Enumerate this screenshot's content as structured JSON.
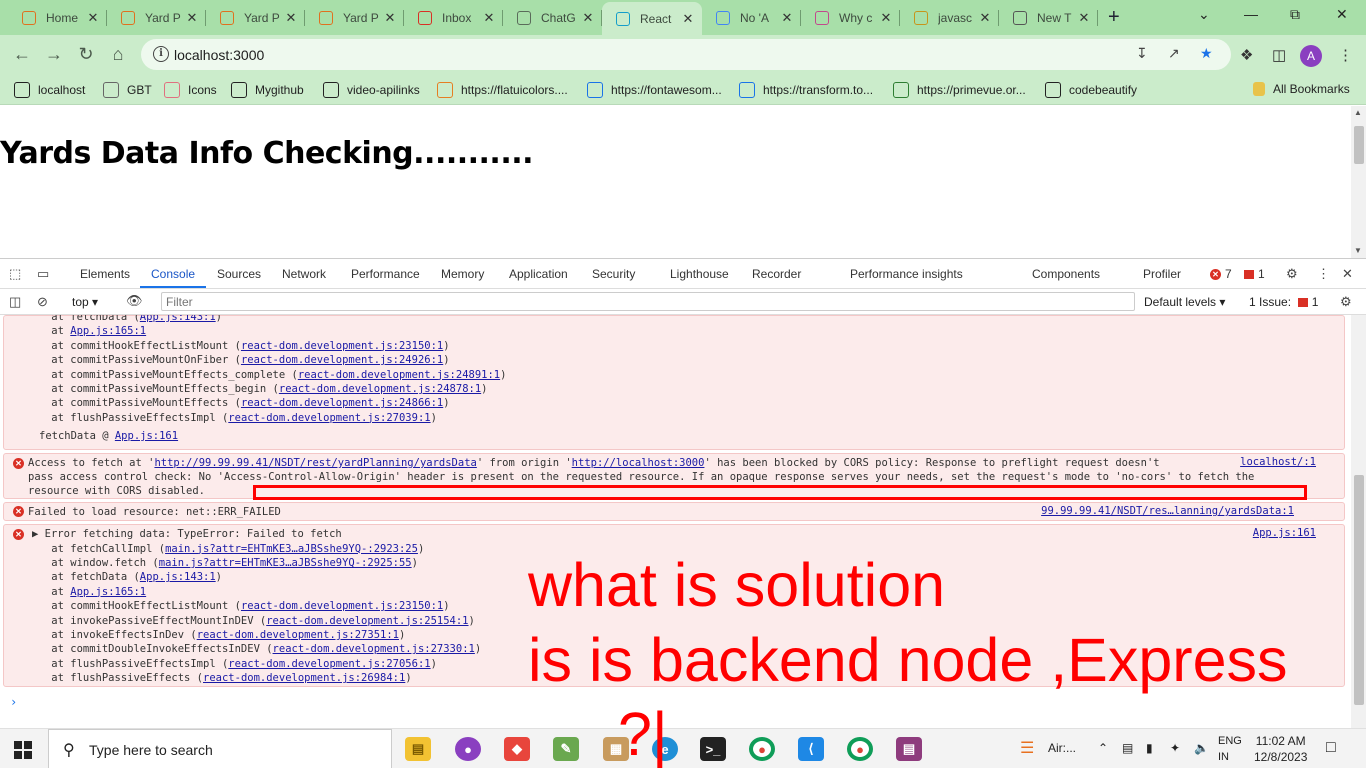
{
  "browser": {
    "tabs": [
      {
        "title": "Home",
        "icon": "react-icon",
        "color": "#e0701f"
      },
      {
        "title": "Yard P",
        "icon": "react-icon",
        "color": "#e0701f"
      },
      {
        "title": "Yard P",
        "icon": "react-icon",
        "color": "#e0701f"
      },
      {
        "title": "Yard P",
        "icon": "react-icon",
        "color": "#e0701f"
      },
      {
        "title": "Inbox",
        "icon": "gmail-icon",
        "color": "#d93025"
      },
      {
        "title": "ChatG",
        "icon": "chatgpt-icon",
        "color": "#5a6b5a"
      },
      {
        "title": "React",
        "icon": "react-icon",
        "color": "#149eca",
        "active": true
      },
      {
        "title": "No 'A",
        "icon": "google-icon",
        "color": "#4285f4"
      },
      {
        "title": "Why c",
        "icon": "triangle-icon",
        "color": "#c2488c"
      },
      {
        "title": "javasc",
        "icon": "pencil-icon",
        "color": "#c7941a"
      },
      {
        "title": "New T",
        "icon": "chrome-icon",
        "color": "#555555"
      }
    ],
    "address": "localhost:3000",
    "avatar_letter": "A",
    "bookmarks": [
      {
        "label": "localhost",
        "icon": "github-icon"
      },
      {
        "label": "GBT",
        "icon": "chatgpt-icon"
      },
      {
        "label": "Icons",
        "icon": "react-icon"
      },
      {
        "label": "Mygithub",
        "icon": "github-icon"
      },
      {
        "label": "video-apilinks",
        "icon": "github-icon"
      },
      {
        "label": "https://flatuicolors....",
        "icon": "flatui-icon"
      },
      {
        "label": "https://fontawesom...",
        "icon": "flag-icon"
      },
      {
        "label": "https://transform.to...",
        "icon": "transform-icon"
      },
      {
        "label": "https://primevue.or...",
        "icon": "primevue-icon"
      },
      {
        "label": "codebeautify",
        "icon": "cb-icon"
      }
    ],
    "all_bookmarks": "All Bookmarks"
  },
  "page": {
    "title": "Yards Data Info Checking..........."
  },
  "devtools": {
    "tabs": [
      "Elements",
      "Console",
      "Sources",
      "Network",
      "Performance",
      "Memory",
      "Application",
      "Security",
      "Lighthouse",
      "Recorder",
      "Performance insights",
      "Components",
      "Profiler"
    ],
    "active_tab": "Console",
    "error_count": "7",
    "issue_count": "1",
    "context": "top",
    "filter_placeholder": "Filter",
    "levels": "Default levels",
    "issues_label": "1 Issue:",
    "issues_num": "1"
  },
  "console": {
    "stack1": [
      {
        "pre": "    at fetchData (",
        "link": "App.js:143:1",
        "post": ")"
      },
      {
        "pre": "    at ",
        "link": "App.js:165:1",
        "post": ""
      },
      {
        "pre": "    at commitHookEffectListMount (",
        "link": "react-dom.development.js:23150:1",
        "post": ")"
      },
      {
        "pre": "    at commitPassiveMountOnFiber (",
        "link": "react-dom.development.js:24926:1",
        "post": ")"
      },
      {
        "pre": "    at commitPassiveMountEffects_complete (",
        "link": "react-dom.development.js:24891:1",
        "post": ")"
      },
      {
        "pre": "    at commitPassiveMountEffects_begin (",
        "link": "react-dom.development.js:24878:1",
        "post": ")"
      },
      {
        "pre": "    at commitPassiveMountEffects (",
        "link": "react-dom.development.js:24866:1",
        "post": ")"
      },
      {
        "pre": "    at flushPassiveEffectsImpl (",
        "link": "react-dom.development.js:27039:1",
        "post": ")"
      }
    ],
    "fetch_at": {
      "pre": "fetchData @ ",
      "link": "App.js:161"
    },
    "cors": {
      "l1_pre": "Access to fetch at '",
      "l1_link1": "http://99.99.99.41/NSDT/rest/yardPlanning/yardsData",
      "l1_mid": "' from origin '",
      "l1_link2": "http://localhost:3000",
      "l1_post": "' has been blocked by CORS policy: Response to preflight request doesn't",
      "l2": "pass access control check: No 'Access-Control-Allow-Origin' header is present on the requested resource. If an opaque response serves your needs, set the request's mode to 'no-cors' to fetch the",
      "l3": "resource with CORS disabled.",
      "src": "localhost/:1"
    },
    "failed": {
      "text": "Failed to load resource: net::ERR_FAILED",
      "src": "99.99.99.41/NSDT/res…lanning/yardsData:1"
    },
    "typeerror": {
      "head": "▶ Error fetching data: TypeError: Failed to fetch",
      "src": "App.js:161",
      "stack": [
        {
          "pre": "    at fetchCallImpl (",
          "link": "main.js?attr=EHTmKE3…aJBSshe9YQ-:2923:25",
          "post": ")"
        },
        {
          "pre": "    at window.fetch (",
          "link": "main.js?attr=EHTmKE3…aJBSshe9YQ-:2925:55",
          "post": ")"
        },
        {
          "pre": "    at fetchData (",
          "link": "App.js:143:1",
          "post": ")"
        },
        {
          "pre": "    at ",
          "link": "App.js:165:1",
          "post": ""
        },
        {
          "pre": "    at commitHookEffectListMount (",
          "link": "react-dom.development.js:23150:1",
          "post": ")"
        },
        {
          "pre": "    at invokePassiveEffectMountInDEV (",
          "link": "react-dom.development.js:25154:1",
          "post": ")"
        },
        {
          "pre": "    at invokeEffectsInDev (",
          "link": "react-dom.development.js:27351:1",
          "post": ")"
        },
        {
          "pre": "    at commitDoubleInvokeEffectsInDEV (",
          "link": "react-dom.development.js:27330:1",
          "post": ")"
        },
        {
          "pre": "    at flushPassiveEffectsImpl (",
          "link": "react-dom.development.js:27056:1",
          "post": ")"
        },
        {
          "pre": "    at flushPassiveEffects (",
          "link": "react-dom.development.js:26984:1",
          "post": ")"
        }
      ]
    },
    "prompt": "›"
  },
  "annotation": {
    "line1": "what is solution",
    "line2": "is is backend  node ,Express",
    "line3": "?|",
    "color": "#ff0000"
  },
  "taskbar": {
    "search_placeholder": "Type here to search",
    "weather": "Air:...",
    "lang1": "ENG",
    "lang2": "IN",
    "time": "11:02 AM",
    "date": "12/8/2023"
  }
}
